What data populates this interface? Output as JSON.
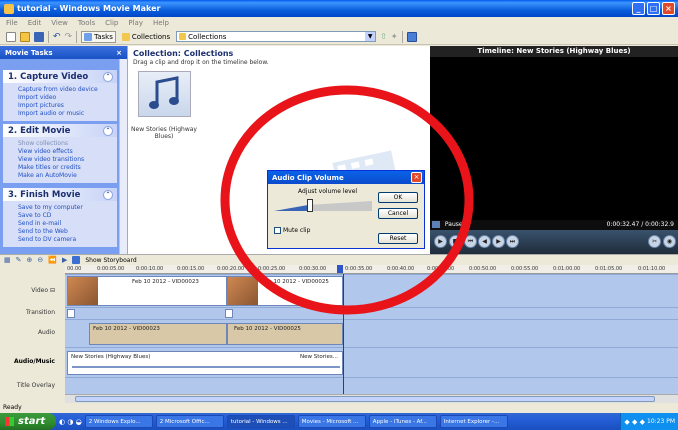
{
  "window": {
    "title": "tutorial - Windows Movie Maker"
  },
  "menu": [
    "File",
    "Edit",
    "View",
    "Tools",
    "Clip",
    "Play",
    "Help"
  ],
  "toolbar": {
    "tasks_label": "Tasks",
    "collections_label": "Collections",
    "combo_value": "Collections"
  },
  "tasks_pane": {
    "header": "Movie Tasks",
    "sections": [
      {
        "title": "1. Capture Video",
        "items": [
          "Capture from video device",
          "Import video",
          "Import pictures",
          "Import audio or music"
        ]
      },
      {
        "title": "2. Edit Movie",
        "items": [
          "Show collections",
          "View video effects",
          "View video transitions",
          "Make titles or credits",
          "Make an AutoMovie"
        ]
      },
      {
        "title": "3. Finish Movie",
        "items": [
          "Save to my computer",
          "Save to CD",
          "Send in e-mail",
          "Send to the Web",
          "Send to DV camera"
        ]
      }
    ]
  },
  "collection": {
    "title": "Collection: Collections",
    "subtitle": "Drag a clip and drop it on the timeline below.",
    "clip_label": "New Stories (Highway Blues)"
  },
  "preview": {
    "title": "Timeline: New Stories (Highway Blues)",
    "status": "Paused",
    "time": "0:00:32.47 / 0:00:32.9"
  },
  "timeline": {
    "storyboard_label": "Show Storyboard",
    "ruler_ticks": [
      "00.00",
      "0:00:05.00",
      "0:00:10.00",
      "0:00:15.00",
      "0:00:20.00",
      "0:00:25.00",
      "0:00:30.00",
      "0:00:35.00",
      "0:00:40.00",
      "0:00:45.00",
      "0:00:50.00",
      "0:00:55.00",
      "0:01:00.00",
      "0:01:05.00",
      "0:01:10.00"
    ],
    "tracks": {
      "video": "Video",
      "transition": "Transition",
      "audio": "Audio",
      "audio_music": "Audio/Music",
      "title_overlay": "Title Overlay"
    },
    "video_clips": [
      "Feb 10 2012 - VID00023",
      "Feb 10 2012 - VID00025"
    ],
    "audio_clips": [
      "Feb 10 2012 - VID00023",
      "Feb 10 2012 - VID00025"
    ],
    "music_clip": "New Stories (Highway Blues)",
    "music_clip_end": "New Stories..."
  },
  "dialog": {
    "title": "Audio Clip Volume",
    "label": "Adjust volume level",
    "ok": "OK",
    "cancel": "Cancel",
    "mute": "Mute clip",
    "reset": "Reset",
    "volume_level": 0.35
  },
  "status_bar": "Ready",
  "taskbar": {
    "start": "start",
    "tasks": [
      "2 Windows Explo...",
      "2 Microsoft Offic...",
      "tutorial - Windows ...",
      "Movies - Microsoft ...",
      "Apple - iTunes - Af...",
      "Internet Explorer -..."
    ],
    "clock": "10:23 PM"
  },
  "colors": {
    "annotation_oval": "#e8141a",
    "xp_blue": "#0a5ddb"
  }
}
